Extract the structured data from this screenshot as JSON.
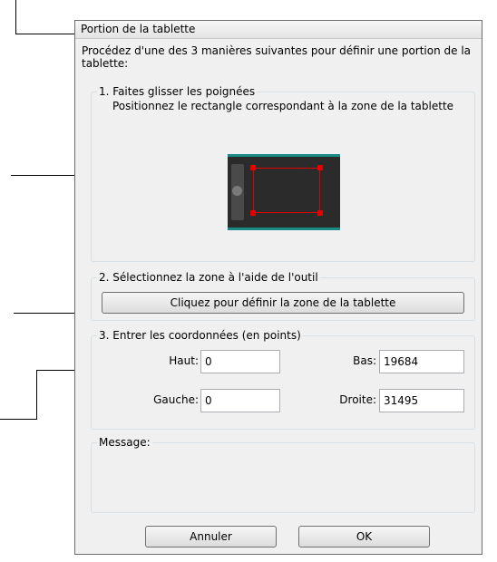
{
  "dialog": {
    "title": "Portion de la tablette",
    "instructions": "Procédez d'une des 3 manières suivantes pour définir une portion de la tablette:"
  },
  "section1": {
    "title": "1. Faites glisser les poignées",
    "subtitle": "Positionnez le rectangle correspondant à la zone de la tablette",
    "colors": {
      "tablet": "#2b2b2b",
      "accent": "#1a8a84",
      "selection": "#e00000"
    }
  },
  "section2": {
    "title": "2. Sélectionnez la zone à l'aide de l'outil",
    "button_label": "Cliquez pour définir la zone de la tablette"
  },
  "section3": {
    "title": "3. Entrer les coordonnées (en points)",
    "top_label": "Haut:",
    "top_value": "0",
    "bottom_label": "Bas:",
    "bottom_value": "19684",
    "left_label": "Gauche:",
    "left_value": "0",
    "right_label": "Droite:",
    "right_value": "31495"
  },
  "message": {
    "title": "Message:"
  },
  "buttons": {
    "cancel": "Annuler",
    "ok": "OK"
  }
}
